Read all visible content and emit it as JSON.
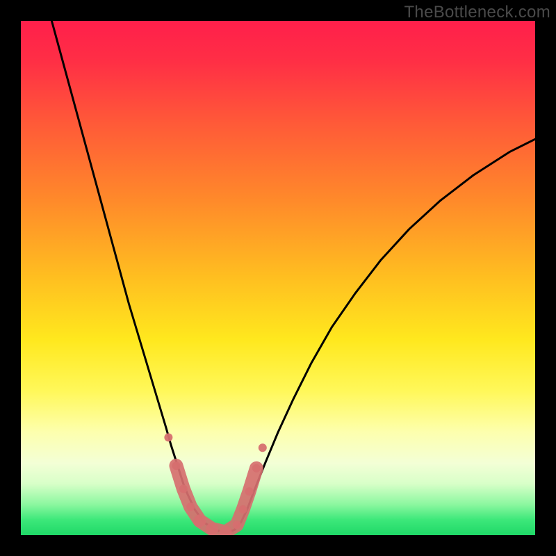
{
  "watermark": "TheBottleneck.com",
  "chart_data": {
    "type": "line",
    "title": "",
    "xlabel": "",
    "ylabel": "",
    "xlim": [
      0,
      1
    ],
    "ylim": [
      0,
      1
    ],
    "background_gradient": {
      "stops": [
        {
          "offset": 0.0,
          "color": "#ff1f4b"
        },
        {
          "offset": 0.08,
          "color": "#ff2f45"
        },
        {
          "offset": 0.2,
          "color": "#ff5a38"
        },
        {
          "offset": 0.35,
          "color": "#ff8a2a"
        },
        {
          "offset": 0.5,
          "color": "#ffbf20"
        },
        {
          "offset": 0.62,
          "color": "#ffe81e"
        },
        {
          "offset": 0.72,
          "color": "#fff85a"
        },
        {
          "offset": 0.8,
          "color": "#fdffae"
        },
        {
          "offset": 0.86,
          "color": "#f3ffd6"
        },
        {
          "offset": 0.9,
          "color": "#d8ffc8"
        },
        {
          "offset": 0.94,
          "color": "#8cf7a0"
        },
        {
          "offset": 0.97,
          "color": "#3de87a"
        },
        {
          "offset": 1.0,
          "color": "#1fd867"
        }
      ]
    },
    "series": [
      {
        "name": "bottleneck-curve",
        "color": "#000000",
        "stroke_width": 3,
        "x": [
          0.06,
          0.075,
          0.09,
          0.105,
          0.12,
          0.135,
          0.15,
          0.165,
          0.18,
          0.195,
          0.21,
          0.225,
          0.24,
          0.255,
          0.27,
          0.282,
          0.292,
          0.3,
          0.308,
          0.316,
          0.324,
          0.338,
          0.356,
          0.378,
          0.4,
          0.415,
          0.428,
          0.44,
          0.455,
          0.475,
          0.5,
          0.53,
          0.565,
          0.605,
          0.65,
          0.7,
          0.755,
          0.815,
          0.88,
          0.95,
          1.0
        ],
        "y": [
          1.0,
          0.945,
          0.89,
          0.835,
          0.78,
          0.725,
          0.67,
          0.615,
          0.56,
          0.505,
          0.45,
          0.4,
          0.35,
          0.3,
          0.25,
          0.21,
          0.175,
          0.15,
          0.125,
          0.1,
          0.08,
          0.05,
          0.025,
          0.01,
          0.005,
          0.01,
          0.025,
          0.05,
          0.09,
          0.14,
          0.2,
          0.265,
          0.335,
          0.405,
          0.47,
          0.535,
          0.595,
          0.65,
          0.7,
          0.745,
          0.77
        ]
      }
    ],
    "markers": {
      "name": "highlight-dots",
      "color": "#d66f6f",
      "radius_small": 6,
      "radius_large": 9,
      "points": [
        {
          "x": 0.287,
          "y": 0.19,
          "r": "small"
        },
        {
          "x": 0.302,
          "y": 0.135,
          "r": "small"
        },
        {
          "x": 0.316,
          "y": 0.09,
          "r": "small"
        },
        {
          "x": 0.33,
          "y": 0.055,
          "r": "small"
        },
        {
          "x": 0.348,
          "y": 0.028,
          "r": "large"
        },
        {
          "x": 0.372,
          "y": 0.012,
          "r": "large"
        },
        {
          "x": 0.398,
          "y": 0.006,
          "r": "large"
        },
        {
          "x": 0.42,
          "y": 0.02,
          "r": "small"
        },
        {
          "x": 0.432,
          "y": 0.05,
          "r": "small"
        },
        {
          "x": 0.444,
          "y": 0.085,
          "r": "small"
        },
        {
          "x": 0.458,
          "y": 0.13,
          "r": "small"
        },
        {
          "x": 0.47,
          "y": 0.17,
          "r": "small"
        }
      ]
    },
    "thick_overlay": {
      "name": "highlight-stroke",
      "color": "#d66f6f",
      "stroke_width": 20,
      "x": [
        0.302,
        0.316,
        0.33,
        0.348,
        0.372,
        0.398,
        0.42,
        0.432,
        0.444,
        0.458
      ],
      "y": [
        0.135,
        0.09,
        0.055,
        0.028,
        0.012,
        0.006,
        0.02,
        0.05,
        0.085,
        0.13
      ]
    }
  }
}
